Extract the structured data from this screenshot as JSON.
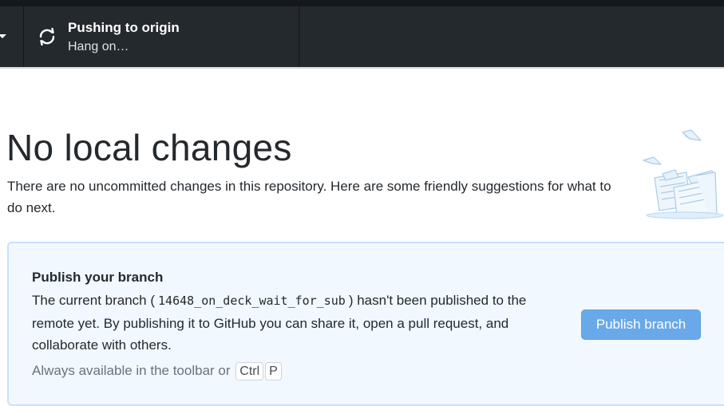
{
  "toolbar": {
    "push": {
      "title": "Pushing to origin",
      "subtitle": "Hang on…",
      "icon": "sync-icon"
    },
    "dropdown_icon": "caret-down-icon"
  },
  "main": {
    "heading": "No local changes",
    "description": "There are no uncommitted changes in this repository. Here are some friendly suggestions for what to do next.",
    "illustration": "empty-state-illustration"
  },
  "publish_card": {
    "title": "Publish your branch",
    "text_before": "The current branch (",
    "branch": "14648_on_deck_wait_for_sub",
    "text_after": ") hasn't been published to the remote yet. By publishing it to GitHub you can share it, open a pull request, and collaborate with others.",
    "hint": "Always available in the toolbar or",
    "shortcut_keys": [
      "Ctrl",
      "P"
    ],
    "button_label": "Publish branch"
  },
  "colors": {
    "toolbar_bg": "#24292e",
    "card_bg": "#f1f8ff",
    "card_border": "#c8e1ff",
    "button_bg": "#6aa9e9"
  }
}
